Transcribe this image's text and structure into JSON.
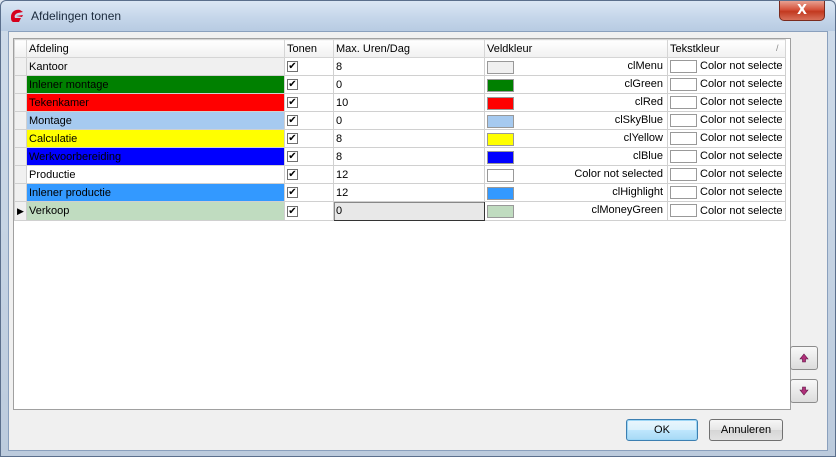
{
  "window": {
    "title": "Afdelingen tonen",
    "close_label": "X"
  },
  "grid": {
    "columns": [
      "Afdeling",
      "Tonen",
      "Max. Uren/Dag",
      "Veldkleur",
      "Tekstkleur"
    ],
    "sort_indicator": "/",
    "rows": [
      {
        "afdeling": "Kantoor",
        "bg": "#f0f0f0",
        "fg": "#000000",
        "tonen": true,
        "max": "8",
        "veld_color": "#f0f0f0",
        "veld_name": "clMenu",
        "tekst": "Color not selecte"
      },
      {
        "afdeling": "Inlener montage",
        "bg": "#008000",
        "fg": "#000000",
        "tonen": true,
        "max": "0",
        "veld_color": "#008000",
        "veld_name": "clGreen",
        "tekst": "Color not selecte"
      },
      {
        "afdeling": "Tekenkamer",
        "bg": "#ff0000",
        "fg": "#000000",
        "tonen": true,
        "max": "10",
        "veld_color": "#ff0000",
        "veld_name": "clRed",
        "tekst": "Color not selecte"
      },
      {
        "afdeling": "Montage",
        "bg": "#a6caf0",
        "fg": "#000000",
        "tonen": true,
        "max": "0",
        "veld_color": "#a6caf0",
        "veld_name": "clSkyBlue",
        "tekst": "Color not selecte"
      },
      {
        "afdeling": "Calculatie",
        "bg": "#ffff00",
        "fg": "#000000",
        "tonen": true,
        "max": "8",
        "veld_color": "#ffff00",
        "veld_name": "clYellow",
        "tekst": "Color not selecte"
      },
      {
        "afdeling": "Werkvoorbereiding",
        "bg": "#0000ff",
        "fg": "#000000",
        "tonen": true,
        "max": "8",
        "veld_color": "#0000ff",
        "veld_name": "clBlue",
        "tekst": "Color not selecte"
      },
      {
        "afdeling": "Productie",
        "bg": "#ffffff",
        "fg": "#000000",
        "tonen": true,
        "max": "12",
        "veld_color": "#ffffff",
        "veld_name": "Color not selected",
        "tekst": "Color not selecte"
      },
      {
        "afdeling": "Inlener productie",
        "bg": "#3399ff",
        "fg": "#000000",
        "tonen": true,
        "max": "12",
        "veld_color": "#3399ff",
        "veld_name": "clHighlight",
        "tekst": "Color not selecte"
      },
      {
        "afdeling": "Verkoop",
        "bg": "#c0dcc0",
        "fg": "#000000",
        "tonen": true,
        "max": "0",
        "veld_color": "#c0dcc0",
        "veld_name": "clMoneyGreen",
        "tekst": "Color not selecte",
        "current": true
      }
    ]
  },
  "side_buttons": {
    "up_icon": "arrow-up-icon",
    "down_icon": "arrow-down-icon"
  },
  "footer": {
    "ok_label": "OK",
    "cancel_label": "Annuleren"
  }
}
